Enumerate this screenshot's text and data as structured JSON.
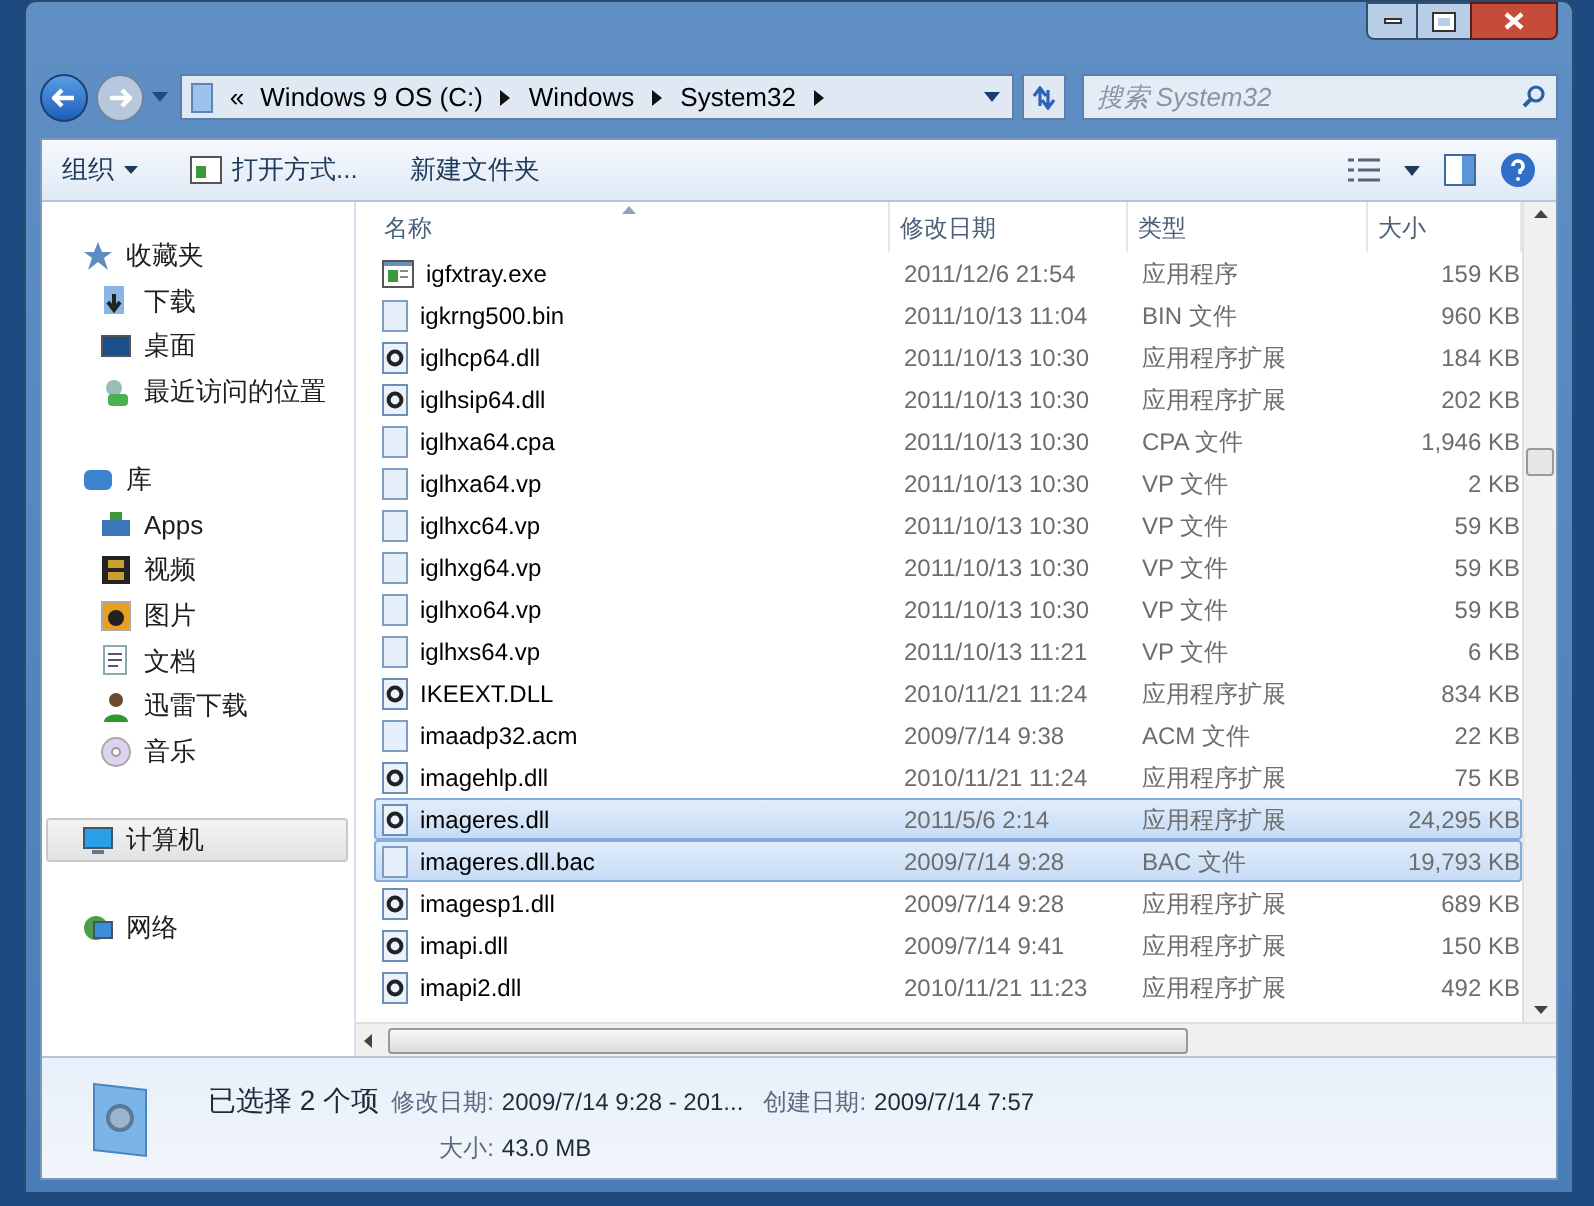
{
  "address_bar": {
    "overflow": "«",
    "crumbs": [
      "Windows 9 OS (C:)",
      "Windows",
      "System32"
    ]
  },
  "search": {
    "placeholder": "搜索 System32"
  },
  "toolbar": {
    "buttons": [
      {
        "label": "组织",
        "kind": "menu"
      },
      {
        "label": "打开方式...",
        "kind": "open"
      },
      {
        "label": "新建文件夹",
        "kind": "plain"
      }
    ]
  },
  "sidebar": {
    "groups": [
      {
        "label": "收藏夹",
        "kind": "star",
        "selected": false,
        "children": [
          {
            "label": "下载",
            "kind": "download"
          },
          {
            "label": "桌面",
            "kind": "desktop"
          },
          {
            "label": "最近访问的位置",
            "kind": "recent"
          }
        ]
      },
      {
        "label": "库",
        "kind": "library",
        "selected": false,
        "children": [
          {
            "label": "Apps",
            "kind": "apps"
          },
          {
            "label": "视频",
            "kind": "video"
          },
          {
            "label": "图片",
            "kind": "picture"
          },
          {
            "label": "文档",
            "kind": "doc"
          },
          {
            "label": "迅雷下载",
            "kind": "person"
          },
          {
            "label": "音乐",
            "kind": "music"
          }
        ]
      },
      {
        "label": "计算机",
        "kind": "computer",
        "selected": true
      },
      {
        "label": "网络",
        "kind": "network",
        "selected": false
      }
    ]
  },
  "table": {
    "columns": [
      "名称",
      "修改日期",
      "类型",
      "大小"
    ],
    "rows": [
      {
        "name": "igfxtray.exe",
        "date": "2011/12/6 21:54",
        "type": "应用程序",
        "size": "159 KB",
        "kind": "exe",
        "selected": false
      },
      {
        "name": "igkrng500.bin",
        "date": "2011/10/13 11:04",
        "type": "BIN 文件",
        "size": "960 KB",
        "kind": "file",
        "selected": false
      },
      {
        "name": "iglhcp64.dll",
        "date": "2011/10/13 10:30",
        "type": "应用程序扩展",
        "size": "184 KB",
        "kind": "dll",
        "selected": false
      },
      {
        "name": "iglhsip64.dll",
        "date": "2011/10/13 10:30",
        "type": "应用程序扩展",
        "size": "202 KB",
        "kind": "dll",
        "selected": false
      },
      {
        "name": "iglhxa64.cpa",
        "date": "2011/10/13 10:30",
        "type": "CPA 文件",
        "size": "1,946 KB",
        "kind": "file",
        "selected": false
      },
      {
        "name": "iglhxa64.vp",
        "date": "2011/10/13 10:30",
        "type": "VP 文件",
        "size": "2 KB",
        "kind": "file",
        "selected": false
      },
      {
        "name": "iglhxc64.vp",
        "date": "2011/10/13 10:30",
        "type": "VP 文件",
        "size": "59 KB",
        "kind": "file",
        "selected": false
      },
      {
        "name": "iglhxg64.vp",
        "date": "2011/10/13 10:30",
        "type": "VP 文件",
        "size": "59 KB",
        "kind": "file",
        "selected": false
      },
      {
        "name": "iglhxo64.vp",
        "date": "2011/10/13 10:30",
        "type": "VP 文件",
        "size": "59 KB",
        "kind": "file",
        "selected": false
      },
      {
        "name": "iglhxs64.vp",
        "date": "2011/10/13 11:21",
        "type": "VP 文件",
        "size": "6 KB",
        "kind": "file",
        "selected": false
      },
      {
        "name": "IKEEXT.DLL",
        "date": "2010/11/21 11:24",
        "type": "应用程序扩展",
        "size": "834 KB",
        "kind": "dll",
        "selected": false
      },
      {
        "name": "imaadp32.acm",
        "date": "2009/7/14 9:38",
        "type": "ACM 文件",
        "size": "22 KB",
        "kind": "file",
        "selected": false
      },
      {
        "name": "imagehlp.dll",
        "date": "2010/11/21 11:24",
        "type": "应用程序扩展",
        "size": "75 KB",
        "kind": "dll",
        "selected": false
      },
      {
        "name": "imageres.dll",
        "date": "2011/5/6 2:14",
        "type": "应用程序扩展",
        "size": "24,295 KB",
        "kind": "dll",
        "selected": true
      },
      {
        "name": "imageres.dll.bac",
        "date": "2009/7/14 9:28",
        "type": "BAC 文件",
        "size": "19,793 KB",
        "kind": "file",
        "selected": true
      },
      {
        "name": "imagesp1.dll",
        "date": "2009/7/14 9:28",
        "type": "应用程序扩展",
        "size": "689 KB",
        "kind": "dll",
        "selected": false
      },
      {
        "name": "imapi.dll",
        "date": "2009/7/14 9:41",
        "type": "应用程序扩展",
        "size": "150 KB",
        "kind": "dll",
        "selected": false
      },
      {
        "name": "imapi2.dll",
        "date": "2010/11/21 11:23",
        "type": "应用程序扩展",
        "size": "492 KB",
        "kind": "dll",
        "selected": false
      }
    ]
  },
  "details": {
    "summary": "已选择 2 个项",
    "fields": [
      {
        "label": "修改日期:",
        "value": "2009/7/14 9:28 - 201..."
      },
      {
        "label": "创建日期:",
        "value": "2009/7/14 7:57"
      },
      {
        "label": "大小:",
        "value": "43.0 MB"
      }
    ]
  }
}
